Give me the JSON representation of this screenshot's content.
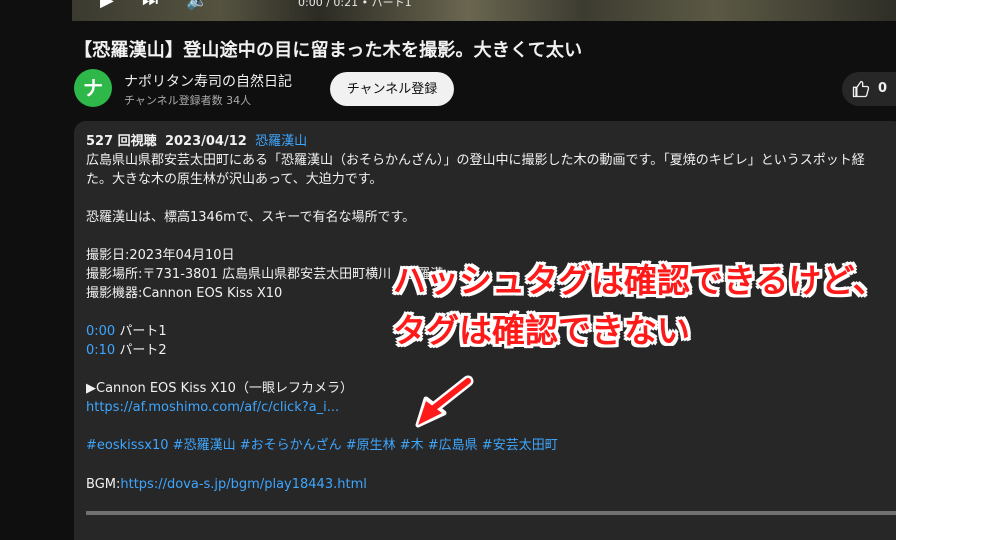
{
  "player": {
    "time": "0:00 / 0:21 • パート1"
  },
  "video": {
    "title": "【恐羅漢山】登山途中の目に留まった木を撮影。大きくて太い"
  },
  "channel": {
    "avatar_letter": "ナ",
    "name": "ナポリタン寿司の自然日記",
    "subscribers": "チャンネル登録者数 34人",
    "subscribe_label": "チャンネル登録"
  },
  "actions": {
    "like_count": "0"
  },
  "description": {
    "views": "527 回視聴",
    "date": "2023/04/12",
    "meta_tag": "恐羅漢山",
    "line1": "広島県山県郡安芸太田町にある「恐羅漢山（おそらかんざん）」の登山中に撮影した木の動画です。「夏焼のキビレ」というスポット経",
    "line2": "た。大きな木の原生林が沢山あって、大迫力です。",
    "line3": "恐羅漢山は、標高1346mで、スキーで有名な場所です。",
    "date_line": "撮影日:2023年04月10日",
    "place_line": "撮影場所:〒731-3801 広島県山県郡安芸太田町横川　恐羅漢",
    "camera_line": "撮影機器:Cannon EOS Kiss X10",
    "chapters": [
      {
        "time": "0:00",
        "label": "パート1"
      },
      {
        "time": "0:10",
        "label": "パート2"
      }
    ],
    "product_line": "▶Cannon EOS Kiss X10（一眼レフカメラ）",
    "product_link": "https://af.moshimo.com/af/c/click?a_i...",
    "hashtags": "#eoskissx10 #恐羅漢山 #おそらかんざん #原生林 #木 #広島県 #安芸太田町",
    "bgm_label": "BGM:",
    "bgm_link": "https://dova-s.jp/bgm/play18443.html"
  },
  "annotation": {
    "line1": "ハッシュタグは確認できるけど、",
    "line2": "タグは確認できない",
    "color": "#ff1a1a"
  }
}
